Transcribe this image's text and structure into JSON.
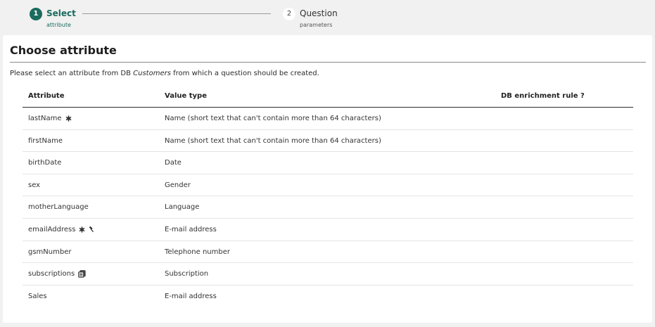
{
  "stepper": {
    "step1": {
      "number": "1",
      "label": "Select",
      "sub": "attribute"
    },
    "step2": {
      "number": "2",
      "label": "Question",
      "sub": "parameters"
    }
  },
  "card": {
    "title": "Choose attribute",
    "intro_prefix": "Please select an attribute from DB ",
    "intro_db": "Customers",
    "intro_suffix": " from which a question should be created."
  },
  "table": {
    "headers": {
      "attribute": "Attribute",
      "value_type": "Value type",
      "enrichment": "DB enrichment rule ?"
    },
    "rows": [
      {
        "attribute": "lastName",
        "value_type": "Name (short text that can't contain more than 64 characters)",
        "icons": [
          "required-icon"
        ]
      },
      {
        "attribute": "firstName",
        "value_type": "Name (short text that can't contain more than 64 characters)",
        "icons": []
      },
      {
        "attribute": "birthDate",
        "value_type": "Date",
        "icons": []
      },
      {
        "attribute": "sex",
        "value_type": "Gender",
        "icons": []
      },
      {
        "attribute": "motherLanguage",
        "value_type": "Language",
        "icons": []
      },
      {
        "attribute": "emailAddress",
        "value_type": "E-mail address",
        "icons": [
          "required-icon",
          "hammer-icon"
        ]
      },
      {
        "attribute": "gsmNumber",
        "value_type": "Telephone number",
        "icons": []
      },
      {
        "attribute": "subscriptions",
        "value_type": "Subscription",
        "icons": [
          "copy-icon"
        ]
      },
      {
        "attribute": "Sales",
        "value_type": "E-mail address",
        "icons": []
      }
    ]
  }
}
